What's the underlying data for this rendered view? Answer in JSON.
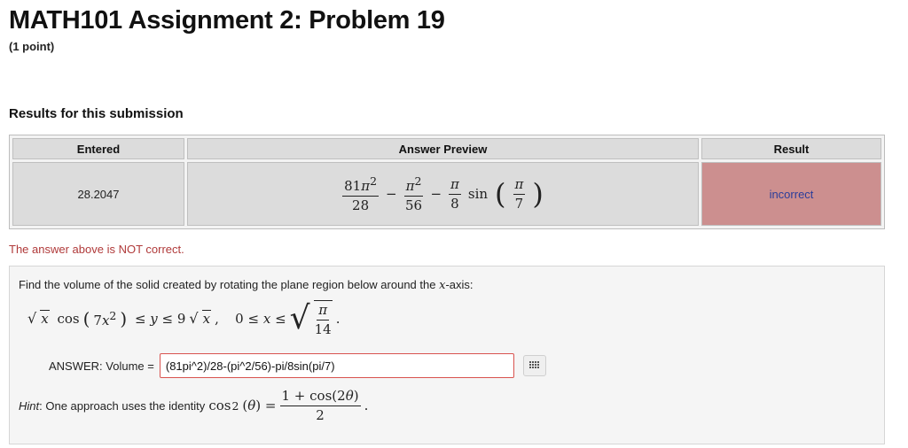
{
  "page": {
    "title": "MATH101 Assignment 2: Problem 19",
    "points": "(1 point)"
  },
  "results": {
    "heading": "Results for this submission",
    "columns": [
      "Entered",
      "Answer Preview",
      "Result"
    ],
    "row": {
      "entered": "28.2047",
      "result": "incorrect"
    },
    "status_message": "The answer above is NOT correct."
  },
  "problem": {
    "statement_prefix": "Find the volume of the solid created by rotating the plane region below around the ",
    "statement_var": "x",
    "statement_suffix": "-axis:",
    "answer_label": "ANSWER: Volume =",
    "answer_value": "(81pi^2)/28-(pi^2/56)-pi/8sin(pi/7)",
    "hint_label": "Hint",
    "hint_text": ": One approach uses the identity "
  },
  "colors": {
    "incorrect_bg": "#cc8f8f",
    "incorrect_text": "#2a3d9a",
    "error_text": "#b03a3a"
  },
  "icons": {
    "equation_editor": "grid-icon"
  }
}
